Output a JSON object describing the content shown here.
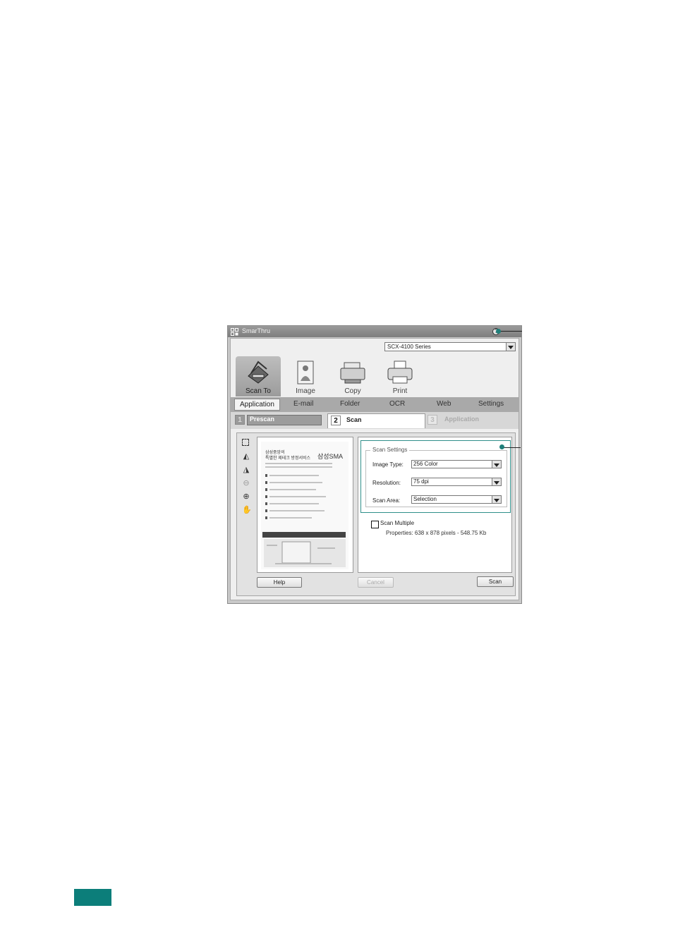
{
  "window": {
    "title": "SmarThru"
  },
  "device_select": {
    "value": "SCX-4100 Series"
  },
  "tools": [
    {
      "label": "Scan To"
    },
    {
      "label": "Image"
    },
    {
      "label": "Copy"
    },
    {
      "label": "Print"
    }
  ],
  "subnav": [
    "Application",
    "E-mail",
    "Folder",
    "OCR",
    "Web",
    "Settings"
  ],
  "steps": [
    {
      "number": "1",
      "label": "Prescan"
    },
    {
      "number": "2",
      "label": "Scan"
    },
    {
      "number": "3",
      "label": "Application"
    }
  ],
  "preview": {
    "doc_heading_1": "삼성중앙의",
    "doc_heading_2": "특별한 제테크 방정서비스",
    "doc_brand": "삼성SMA"
  },
  "scan_settings": {
    "legend": "Scan Settings",
    "image_type_label": "Image Type:",
    "image_type_value": "256 Color",
    "resolution_label": "Resolution:",
    "resolution_value": "75 dpi",
    "scan_area_label": "Scan Area:",
    "scan_area_value": "Selection"
  },
  "scan_multiple": {
    "label": "Scan Multiple",
    "checked": false
  },
  "properties": "Properties: 638 x 878 pixels - 548.75 Kb",
  "buttons": {
    "help": "Help",
    "cancel": "Cancel",
    "scan": "Scan"
  },
  "colors": {
    "accent": "#1f7f7a",
    "page_tab": "#0c7e7a"
  }
}
